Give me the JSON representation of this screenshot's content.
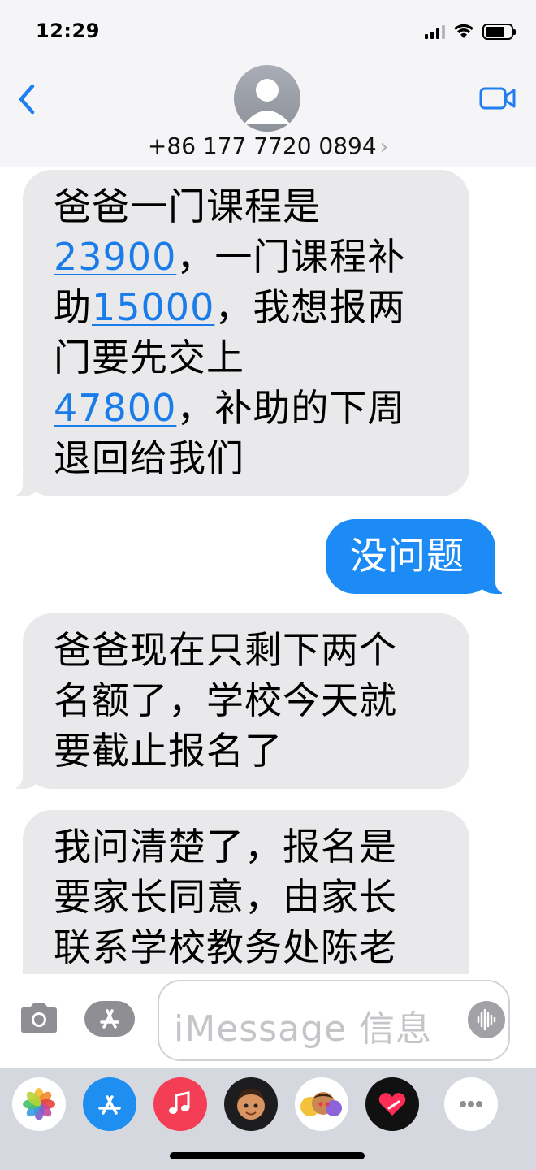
{
  "status_bar": {
    "time": "12:29",
    "battery_level": 0.75
  },
  "header": {
    "contact": "+86 177 7720 0894",
    "chevron": "›"
  },
  "messages": [
    {
      "direction": "incoming",
      "lines": [
        {
          "text": "爸爸一门课程是"
        },
        {
          "link": "23900",
          "text": "，一门课程补"
        },
        {
          "pre": "助",
          "link": "15000",
          "text": "，我想报两"
        },
        {
          "text": "门要先交上"
        },
        {
          "link": "47800",
          "text": "，补助的下周"
        },
        {
          "text": "退回给我们"
        }
      ]
    },
    {
      "direction": "outgoing",
      "lines": [
        {
          "text": "没问题"
        }
      ]
    },
    {
      "direction": "incoming",
      "lines": [
        {
          "text": "爸爸现在只剩下两个"
        },
        {
          "text": "名额了，学校今天就"
        },
        {
          "text": "要截止报名了"
        }
      ]
    },
    {
      "direction": "incoming",
      "lines": [
        {
          "text": "我问清楚了，报名是"
        },
        {
          "text": "要家长同意，由家长"
        },
        {
          "text": "联系学校教务处陈老"
        }
      ]
    }
  ],
  "input": {
    "placeholder": "iMessage 信息"
  },
  "apps": [
    {
      "icon": "photos-app-icon",
      "color": "#ffffff"
    },
    {
      "icon": "app-store-icon",
      "color": "#1f8ef1"
    },
    {
      "icon": "music-app-icon",
      "color": "#f43e55"
    },
    {
      "icon": "memoji-icon",
      "color": "#1d1d1f"
    },
    {
      "icon": "memoji-stickers-icon",
      "color": "#ffffff"
    },
    {
      "icon": "digital-touch-icon",
      "color": "#111111"
    },
    {
      "icon": "more-apps-icon",
      "color": "#ffffff"
    }
  ],
  "colors": {
    "incoming_bubble": "#e9e9eb",
    "outgoing_bubble": "#1d8bf5",
    "link": "#1a7ce8",
    "accent": "#1f7ff0"
  }
}
